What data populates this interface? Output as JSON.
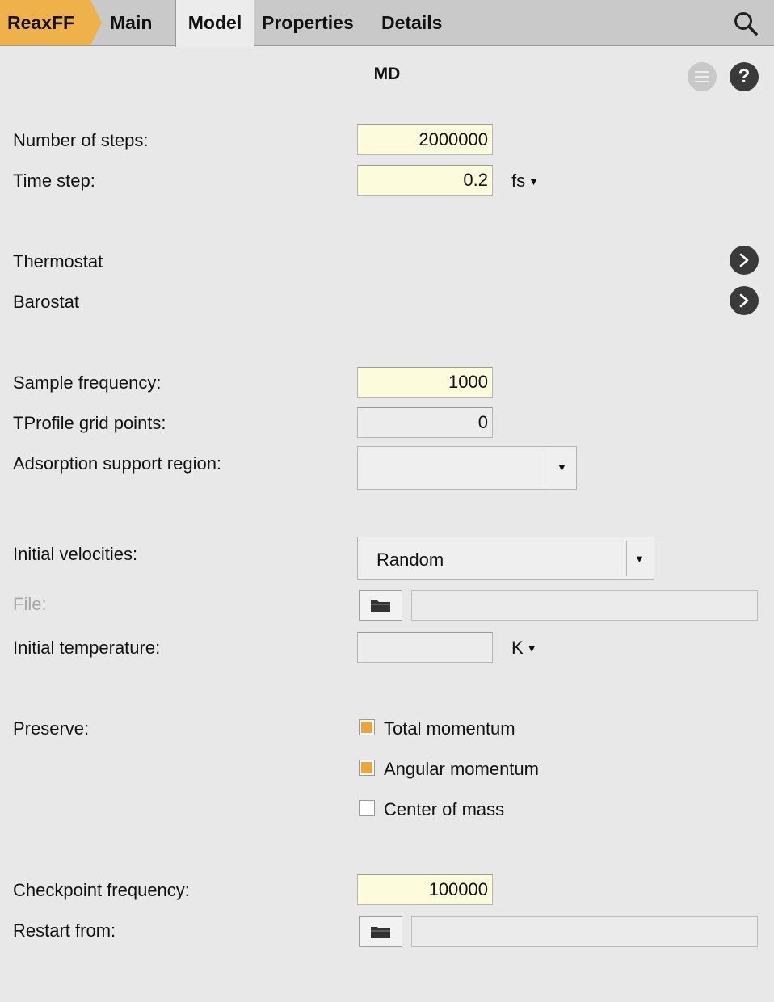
{
  "tabs": {
    "app": "ReaxFF",
    "main": "Main",
    "model": "Model",
    "properties": "Properties",
    "details": "Details"
  },
  "panel": {
    "title": "MD"
  },
  "fields": {
    "num_steps": {
      "label": "Number of steps:",
      "value": "2000000"
    },
    "time_step": {
      "label": "Time step:",
      "value": "0.2",
      "unit": "fs"
    },
    "thermostat": {
      "label": "Thermostat"
    },
    "barostat": {
      "label": "Barostat"
    },
    "sample_frequency": {
      "label": "Sample frequency:",
      "value": "1000"
    },
    "tprofile_grid": {
      "label": "TProfile grid points:",
      "value": "0"
    },
    "adsorption_region": {
      "label": "Adsorption support region:",
      "value": ""
    },
    "initial_velocities": {
      "label": "Initial velocities:",
      "value": "Random"
    },
    "file": {
      "label": "File:",
      "path": ""
    },
    "initial_temperature": {
      "label": "Initial temperature:",
      "value": "",
      "unit": "K"
    },
    "preserve": {
      "label": "Preserve:",
      "options": [
        {
          "label": "Total momentum",
          "checked": true
        },
        {
          "label": "Angular momentum",
          "checked": true
        },
        {
          "label": "Center of mass",
          "checked": false
        }
      ]
    },
    "checkpoint_frequency": {
      "label": "Checkpoint frequency:",
      "value": "100000"
    },
    "restart_from": {
      "label": "Restart from:",
      "path": ""
    }
  },
  "colors": {
    "accent": "#efb14a",
    "highlight_field": "#fcfbdc",
    "checkbox_on": "#f0a33a"
  }
}
